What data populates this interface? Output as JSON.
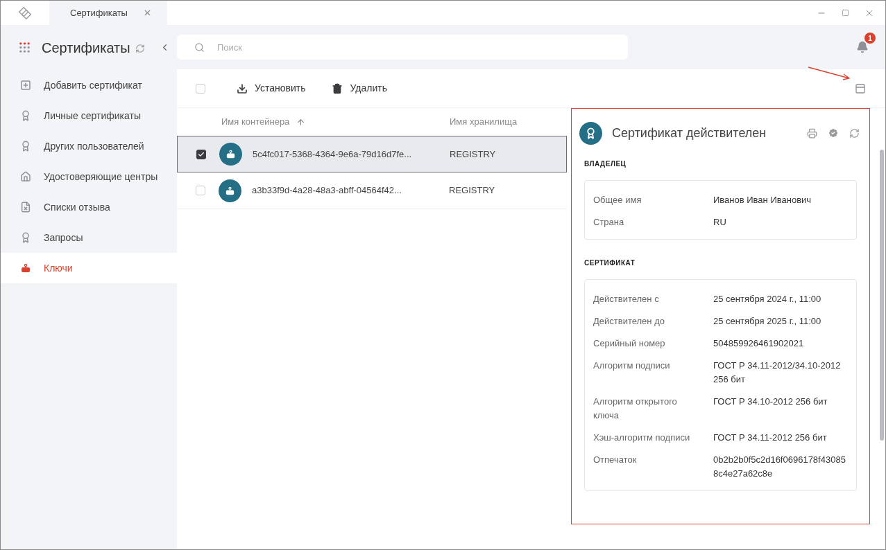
{
  "window": {
    "tab": "Сертификаты"
  },
  "app_title": "Сертификаты",
  "sidebar": {
    "items": [
      {
        "label": "Добавить сертификат",
        "selected": false
      },
      {
        "label": "Личные сертификаты",
        "selected": false
      },
      {
        "label": "Других пользователей",
        "selected": false
      },
      {
        "label": "Удостоверяющие центры",
        "selected": false
      },
      {
        "label": "Списки отзыва",
        "selected": false
      },
      {
        "label": "Запросы",
        "selected": false
      },
      {
        "label": "Ключи",
        "selected": true
      }
    ]
  },
  "search": {
    "placeholder": "Поиск"
  },
  "notifications": {
    "count": "1"
  },
  "toolbar": {
    "select_all": false,
    "buttons": [
      {
        "label": "Установить",
        "kind": "install"
      },
      {
        "label": "Удалить",
        "kind": "delete"
      }
    ]
  },
  "table": {
    "columns": [
      "Имя контейнера",
      "Имя хранилища"
    ],
    "rows": [
      {
        "checked": true,
        "selected": true,
        "container": "5c4fc017-5368-4364-9e6a-79d16d7fe...",
        "storage": "REGISTRY"
      },
      {
        "checked": false,
        "selected": false,
        "container": "a3b33f9d-4a28-48a3-abff-04564f42...",
        "storage": "REGISTRY"
      }
    ]
  },
  "details": {
    "title": "Сертификат действителен",
    "sections": [
      {
        "title": "ВЛАДЕЛЕЦ",
        "fields": [
          {
            "label": "Общее имя",
            "value": "Иванов Иван Иванович"
          },
          {
            "label": "Страна",
            "value": "RU"
          }
        ]
      },
      {
        "title": "СЕРТИФИКАТ",
        "fields": [
          {
            "label": "Действителен с",
            "value": "25 сентября 2024 г., 11:00"
          },
          {
            "label": "Действителен до",
            "value": "25 сентября 2025 г., 11:00"
          },
          {
            "label": "Серийный номер",
            "value": "504859926461902021"
          },
          {
            "label": "Алгоритм подписи",
            "value": "ГОСТ Р 34.11-2012/34.10-2012 256 бит"
          },
          {
            "label": "Алгоритм открытого ключа",
            "value": "ГОСТ Р 34.10-2012 256 бит"
          },
          {
            "label": "Хэш-алгоритм подписи",
            "value": "ГОСТ Р 34.11-2012 256 бит"
          },
          {
            "label": "Отпечаток",
            "value": "0b2b2b0f5c2d16f0696178f430858c4e27a62c8e"
          }
        ]
      }
    ]
  }
}
